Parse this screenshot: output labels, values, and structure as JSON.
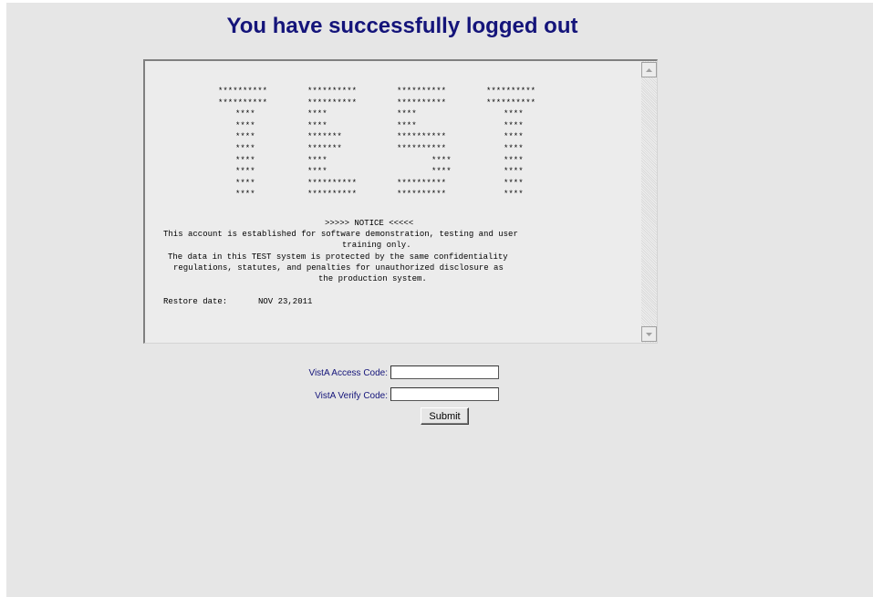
{
  "header": {
    "title": "You have successfully logged out"
  },
  "notice": {
    "banner_rows": [
      [
        "**********",
        "**********",
        "**********",
        "**********"
      ],
      [
        "**********",
        "**********",
        "**********",
        "**********"
      ],
      [
        "****",
        "****",
        "****",
        "****"
      ],
      [
        "****",
        "****",
        "****",
        "****"
      ],
      [
        "****",
        "*******",
        "**********",
        "****"
      ],
      [
        "****",
        "*******",
        "**********",
        "****"
      ],
      [
        "****",
        "****",
        "****",
        "****"
      ],
      [
        "****",
        "****",
        "****",
        "****"
      ],
      [
        "****",
        "**********",
        "**********",
        "****"
      ],
      [
        "****",
        "**********",
        "**********",
        "****"
      ]
    ],
    "heading": ">>>>> NOTICE <<<<<",
    "line1": "This account is established for software demonstration, testing and user",
    "line2": "training only.",
    "line3": "The data in this TEST system is protected by the same confidentiality",
    "line4": "regulations, statutes, and penalties for unauthorized disclosure as",
    "line5": "the production system.",
    "restore_label": "Restore date:",
    "restore_value": "NOV 23,2011"
  },
  "form": {
    "access_label": "VistA Access Code:",
    "access_value": "",
    "verify_label": "VistA Verify Code:",
    "verify_value": "",
    "submit_label": "Submit"
  }
}
